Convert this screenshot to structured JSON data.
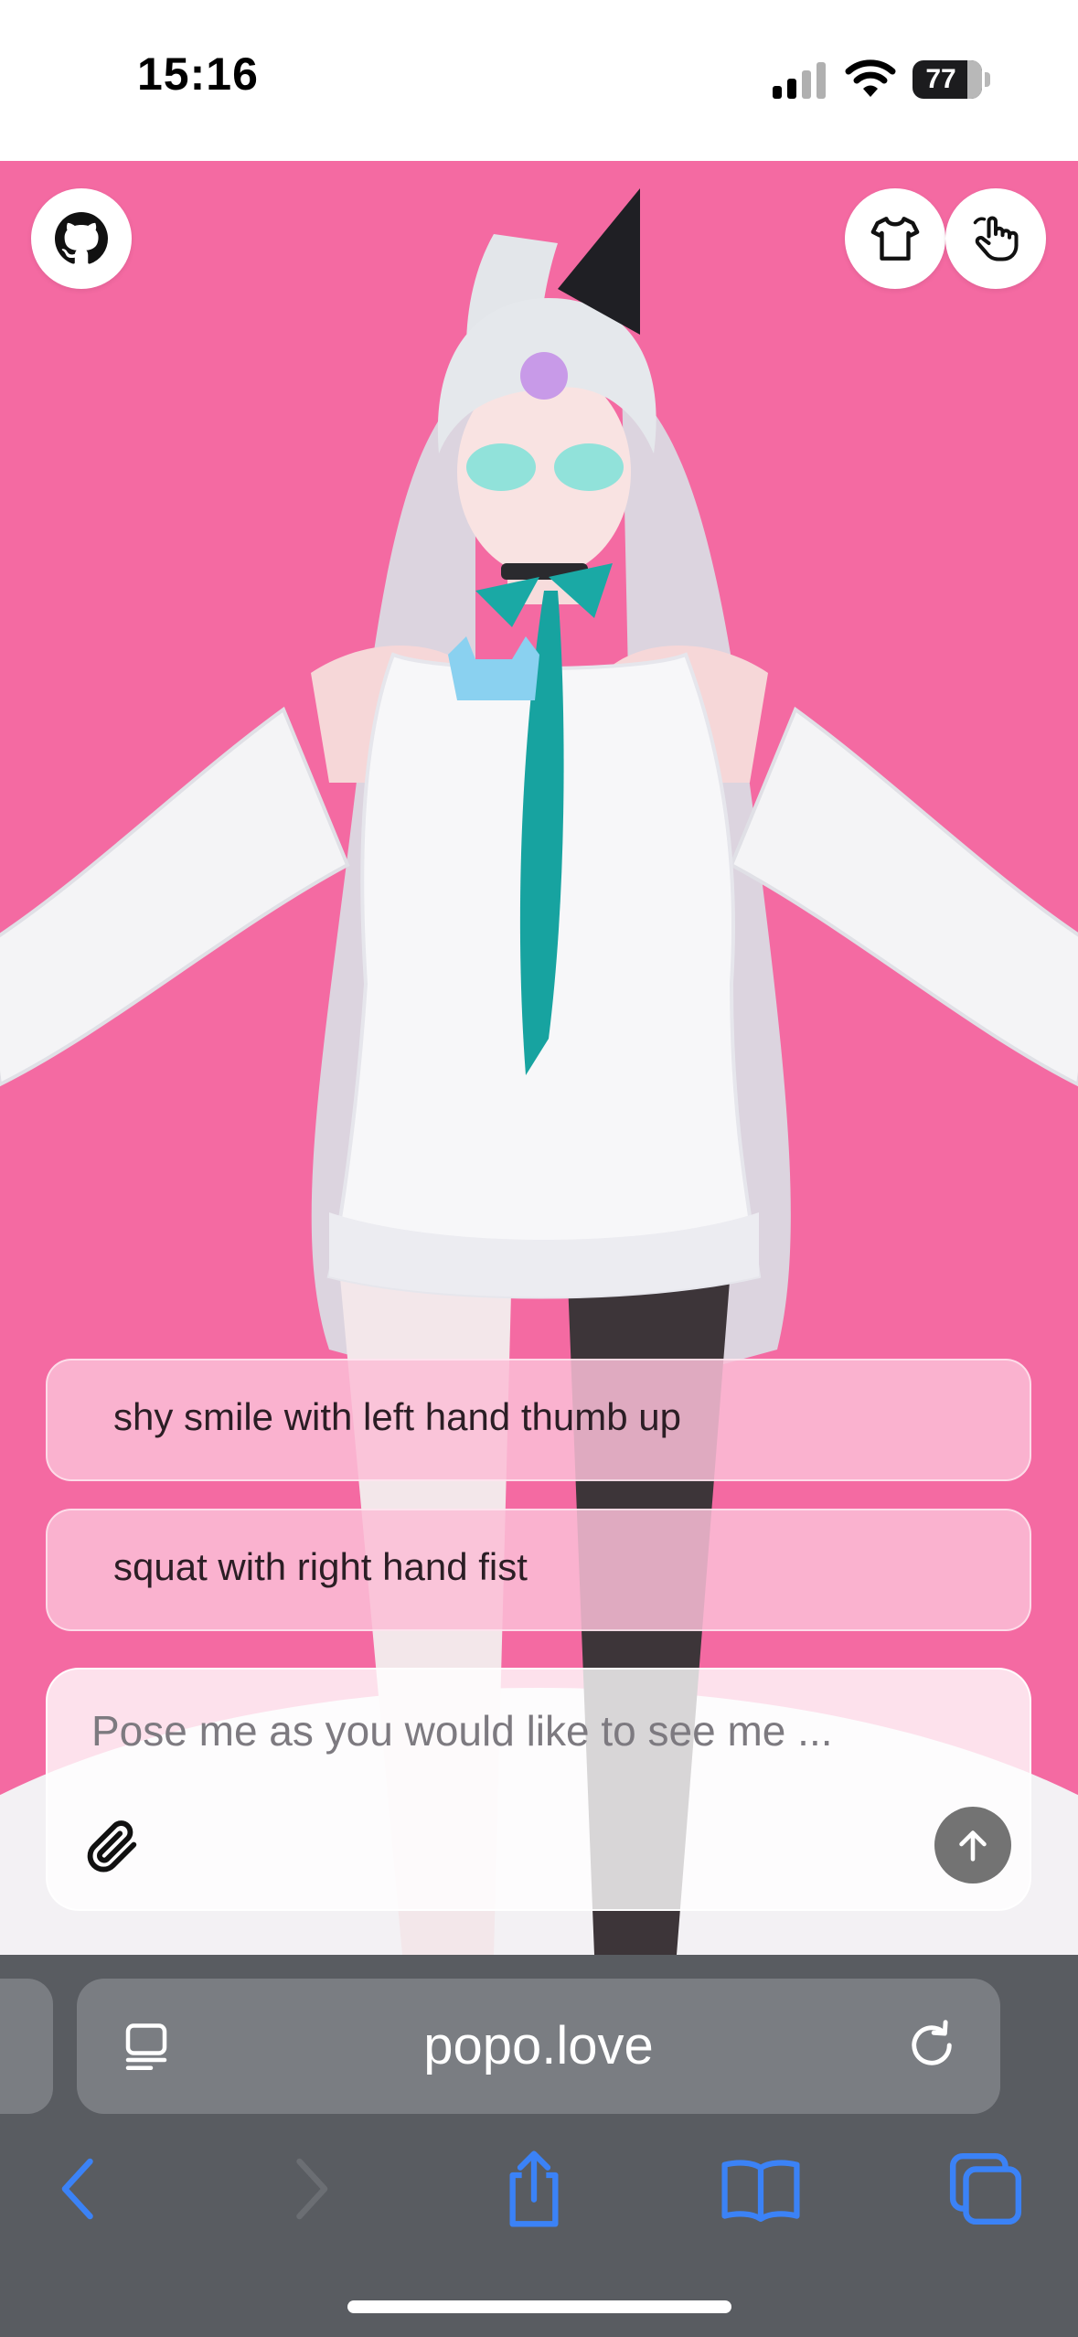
{
  "status_bar": {
    "time": "15:16",
    "battery_level": "77"
  },
  "header": {
    "github_icon": "github-icon",
    "outfit_icon": "tshirt-icon",
    "pose_icon": "hand-pointer-icon"
  },
  "suggestions": [
    {
      "label": "shy smile with left hand thumb up"
    },
    {
      "label": "squat with right hand fist"
    }
  ],
  "composer": {
    "placeholder": "Pose me as you would like to see me ...",
    "value": "",
    "attach_icon": "paperclip-icon",
    "send_icon": "arrow-up-icon"
  },
  "browser": {
    "url": "popo.love",
    "reader_icon": "reader-mode-icon",
    "reload_icon": "reload-icon",
    "toolbar_icons": [
      "back-icon",
      "forward-icon",
      "share-icon",
      "bookmarks-icon",
      "tabs-icon"
    ]
  },
  "colors": {
    "scene_background": "#f46aa2",
    "suggestion_background": "#fabed6",
    "browser_chrome": "#595c61",
    "toolbar_accent": "#3b82f6"
  }
}
